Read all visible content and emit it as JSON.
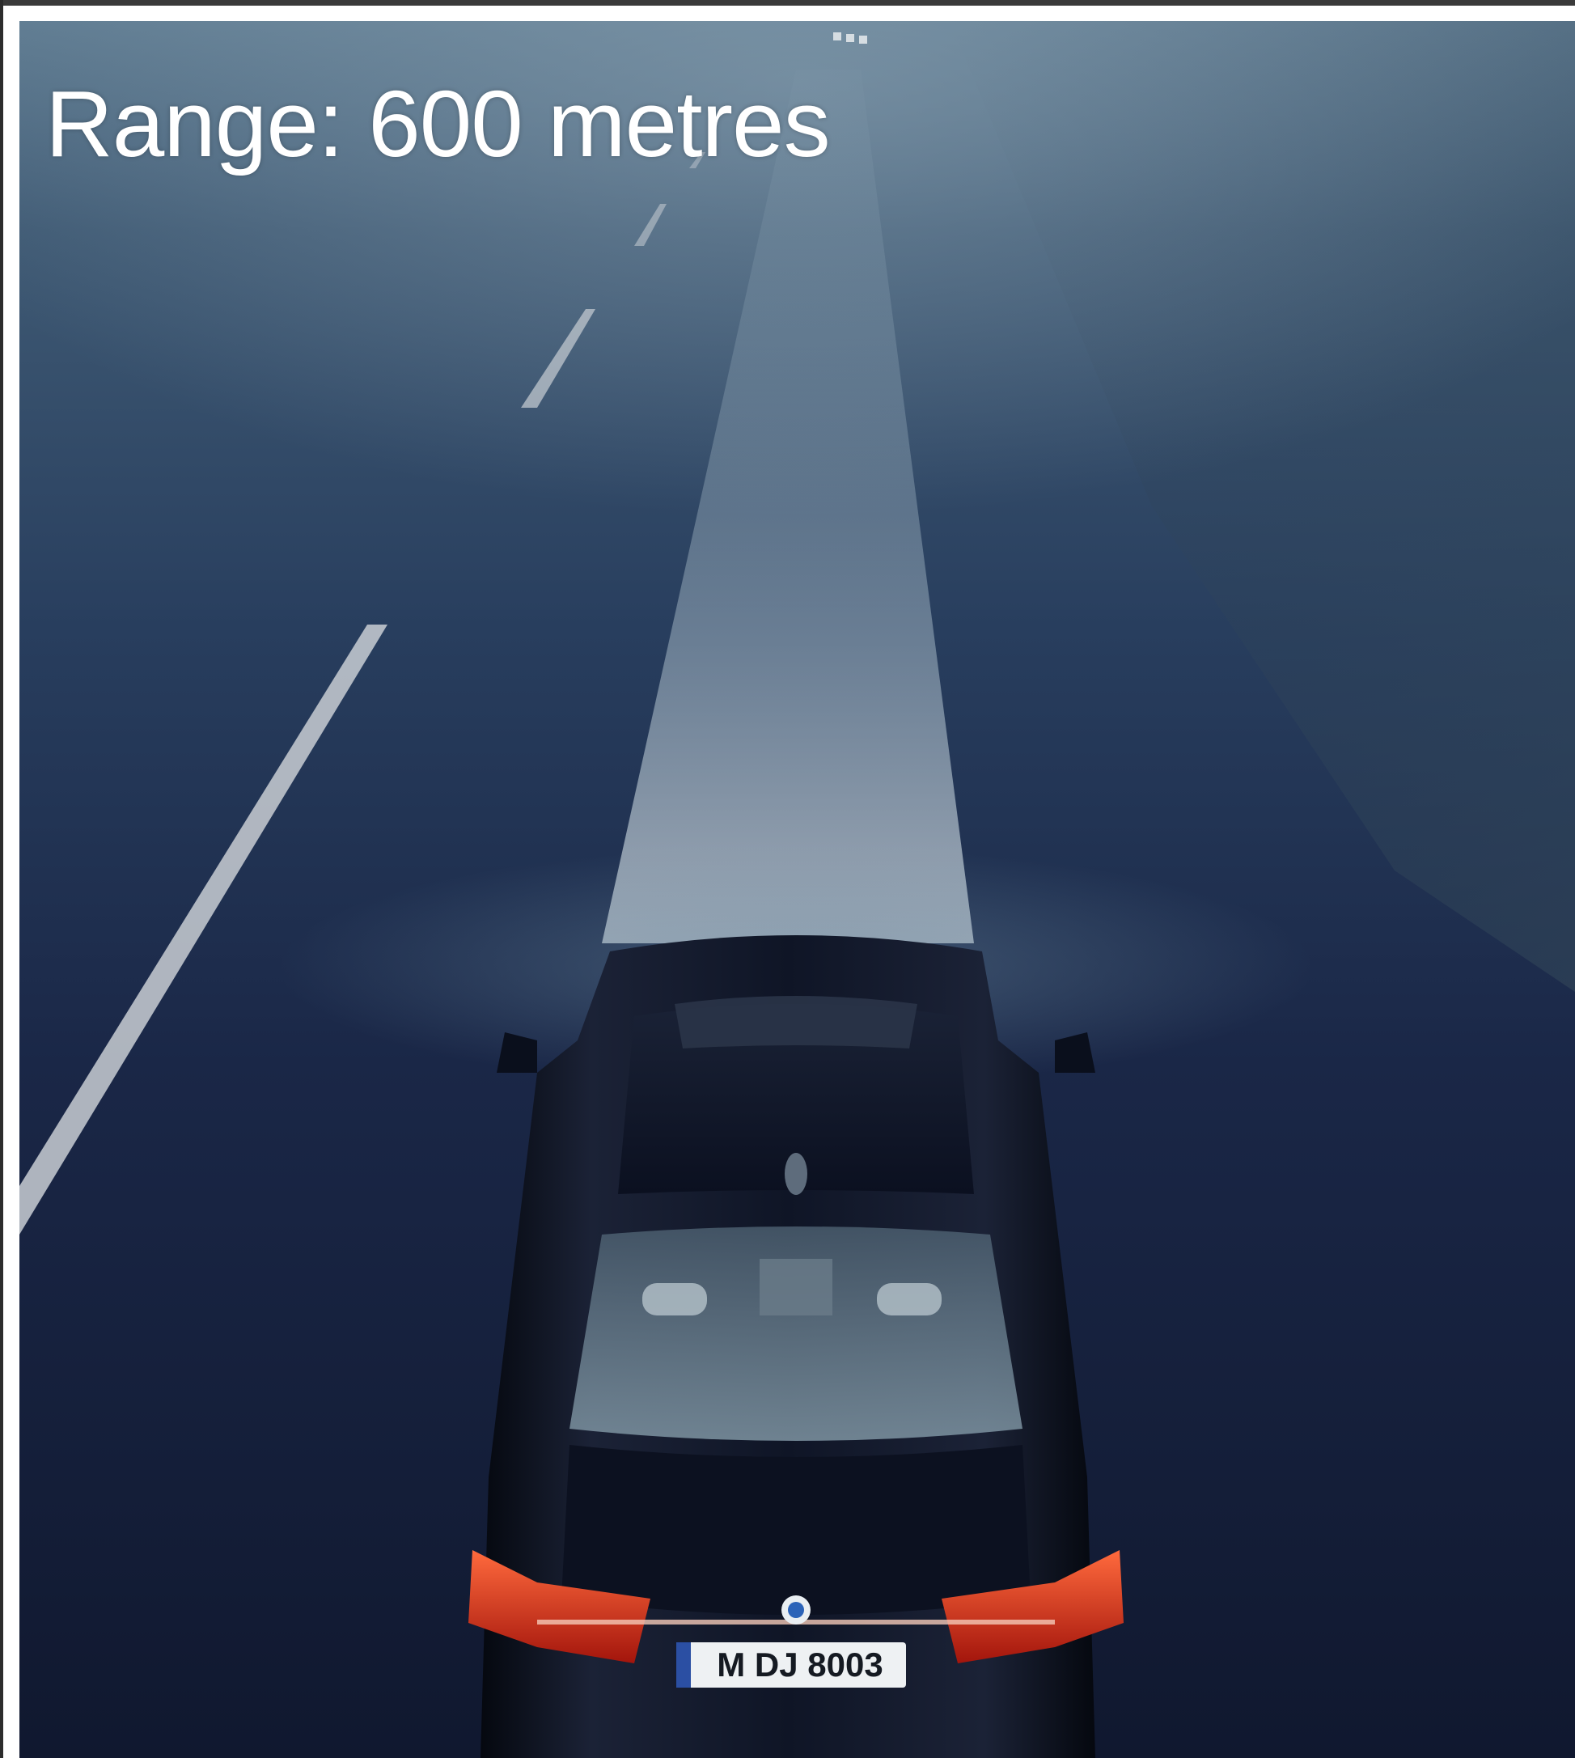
{
  "caption": {
    "text": "Range: 600 metres",
    "color": "#ffffff"
  },
  "photo": {
    "plate_text": "M DJ 8003",
    "icons": [
      "car-icon",
      "headlight-beam-icon",
      "road-lane-marking-icon",
      "tail-light-icon",
      "brand-emblem-icon",
      "license-plate-icon"
    ],
    "colors": {
      "sky_fog": "#4f6e86",
      "asphalt": "#141e38",
      "beam": "#d8e6ec",
      "car_body": "#0d1220",
      "tail_light": "#e03a20",
      "lane_marking": "#c9ced4"
    }
  }
}
